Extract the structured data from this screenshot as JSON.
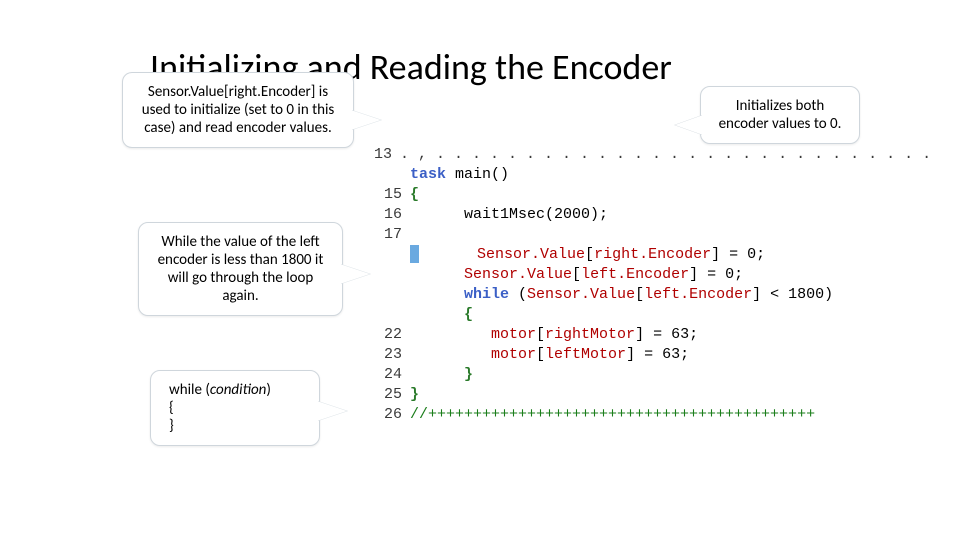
{
  "title": "Initializing and Reading the Encoder",
  "callouts": {
    "c1": "Sensor.Value[right.Encoder] is used to initialize (set to 0 in this case) and read encoder values.",
    "c2": "Initializes both encoder values to 0.",
    "c3": "While the value of the left encoder is less than 1800 it will go through the loop again.",
    "c4_while": "while (",
    "c4_cond": "condition",
    "c4_close": ")",
    "c4_l2": "{",
    "c4_l3": "}"
  },
  "code": {
    "dots": ". , . . . . . . . . . . . . . . . . . . . . . . . . . . . .              . . . . . . . . . . . . . . . . . . . . . . . . ",
    "l13_num": "13",
    "l13_task": "task",
    "l13_main": " main()",
    "l14_num": "  ",
    "l14_brace": "{",
    "l15_num": "15",
    "l16_num": "16",
    "l16_wait": "      wait1Msec(2000);",
    "l17_num": "17",
    "l18_ind": "      ",
    "l18_sv": "Sensor.Value",
    "l18_b": "[",
    "l18_re": "right.Encoder",
    "l18_e": "] = 0;",
    "l19_ind": "      ",
    "l19_sv": "Sensor.Value",
    "l19_b": "[",
    "l19_le": "left.Encoder",
    "l19_e": "] = 0;",
    "l20_ind": "      ",
    "l20_while": "while",
    "l20_paren": " (",
    "l20_sv": "Sensor.Value",
    "l20_b": "[",
    "l20_le": "left.Encoder",
    "l20_e": "] < 1800)",
    "l21_ind": "      ",
    "l21_brace": "{",
    "l22_num": "22",
    "l22_ind": "         ",
    "l22_motor": "motor",
    "l22_b": "[",
    "l22_rm": "rightMotor",
    "l22_e": "] = 63;",
    "l23_num": "23",
    "l23_ind": "         ",
    "l23_motor": "motor",
    "l23_b": "[",
    "l23_lm": "leftMotor",
    "l23_e": "] = 63;",
    "l24_num": "24",
    "l24_ind": "      ",
    "l24_brace": "}",
    "l25_num": "25",
    "l25_brace": "}",
    "l26_num": "26",
    "l26_comment": "//+++++++++++++++++++++++++++++++++++++++++++"
  }
}
